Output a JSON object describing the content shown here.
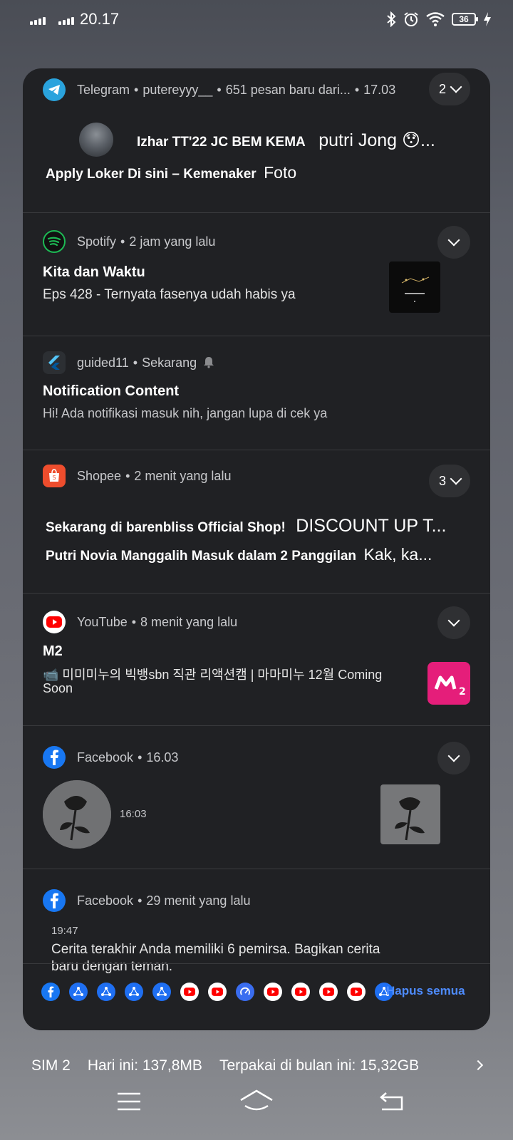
{
  "status_bar": {
    "time": "20.17",
    "battery_level": "36"
  },
  "notifications": {
    "telegram": {
      "app": "Telegram",
      "account": "putereyyy__",
      "summary": "651 pesan baru dari...",
      "time": "17.03",
      "count": "2",
      "line1_sender": "Izhar TT'22 JC BEM KEMA",
      "line1_message": "putri Jong 😯...",
      "line2_sender": "Apply Loker Di sini – Kemenaker",
      "line2_message": "Foto"
    },
    "spotify": {
      "app": "Spotify",
      "time": "2 jam yang lalu",
      "title": "Kita dan Waktu",
      "text": "Eps 428 - Ternyata fasenya udah habis ya"
    },
    "guided": {
      "app": "guided11",
      "time": "Sekarang",
      "title": "Notification Content",
      "text": "Hi! Ada notifikasi masuk nih, jangan lupa di cek ya"
    },
    "shopee": {
      "app": "Shopee",
      "time": "2 menit yang lalu",
      "count": "3",
      "line1_sender": "Sekarang di barenbliss Official Shop!",
      "line1_message": "DISCOUNT UP T...",
      "line2_sender": "Putri Novia Manggalih Masuk dalam 2 Panggilan",
      "line2_message": "Kak, ka..."
    },
    "youtube": {
      "app": "YouTube",
      "time": "8 menit yang lalu",
      "title": "M2",
      "text_line1": "📹 미미미누의 빅뱅sbn 직관 리액션캠 | 마마미누 12월 Coming",
      "text_line2": "Soon"
    },
    "facebook1": {
      "app": "Facebook",
      "time": "16.03",
      "inline_time": "16:03"
    },
    "facebook2": {
      "app": "Facebook",
      "time": "29 menit yang lalu",
      "inline_time": "19:47",
      "text_line1": "Cerita terakhir Anda memiliki 6 pemirsa. Bagikan cerita",
      "text_line2": "baru dengan teman."
    }
  },
  "app_row": {
    "icons": [
      "facebook-icon",
      "share-icon",
      "share-icon",
      "share-icon",
      "share-icon",
      "youtube-icon",
      "youtube-icon",
      "speed-icon",
      "youtube-icon",
      "youtube-icon",
      "youtube-icon",
      "youtube-icon",
      "share-icon"
    ],
    "clear_all_label": "Hapus semua"
  },
  "data_usage": {
    "sim": "SIM 2",
    "today": "Hari ini: 137,8MB",
    "month": "Terpakai di bulan ini: 15,32GB"
  },
  "colors": {
    "panel": "#202124",
    "accent_blue": "#4e8cff",
    "telegram": "#2aa3dd",
    "spotify": "#1db954",
    "shopee": "#ee4d2d",
    "youtube": "#ff0000",
    "facebook": "#1877f2"
  }
}
